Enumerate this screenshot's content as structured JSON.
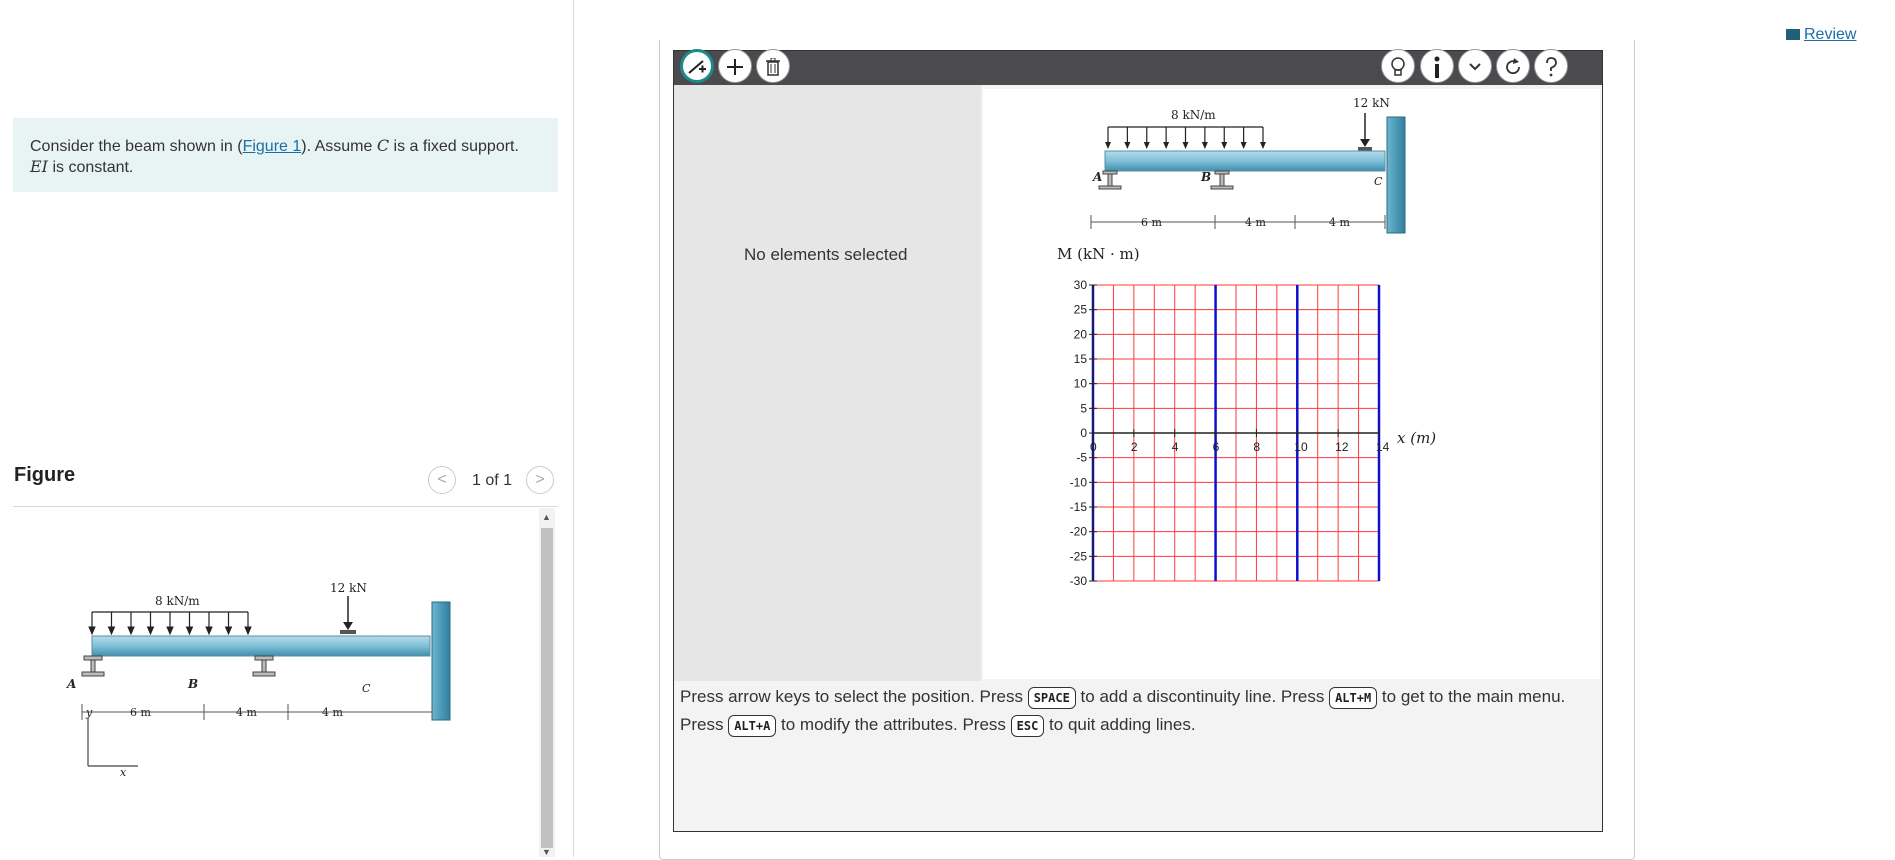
{
  "problem": {
    "text_pre": "Consider the beam shown in (",
    "figure_link": "Figure 1",
    "text_mid": "). Assume ",
    "support_symbol": "C",
    "text_post": " is a fixed support.",
    "ei_symbol": "EI",
    "ei_text": " is constant."
  },
  "figure_panel": {
    "heading": "Figure",
    "pager": "1 of 1",
    "prev_glyph": "<",
    "next_glyph": ">"
  },
  "beam_figure": {
    "distributed_load": "8 kN/m",
    "point_load": "12 kN",
    "label_a": "A",
    "label_b": "B",
    "label_c": "C",
    "dim_1": "6 m",
    "dim_2": "4 m",
    "dim_3": "4 m",
    "axis_y": "y",
    "axis_x": "x"
  },
  "toolbar": {
    "tools": [
      "add-discontinuity-line-tool",
      "plus-icon",
      "trash-icon"
    ],
    "right_tools": [
      "hint-lightbulb-icon",
      "info-icon",
      "chevron-down-icon",
      "reset-icon",
      "help-icon"
    ]
  },
  "info_pane": {
    "status": "No elements selected"
  },
  "chart_data": {
    "type": "line",
    "ylabel": "M (kN · m)",
    "xlabel": "x (m)",
    "xlim": [
      0,
      14
    ],
    "ylim": [
      -30,
      30
    ],
    "x_ticks": [
      0,
      2,
      4,
      6,
      8,
      10,
      12,
      14
    ],
    "y_ticks": [
      30,
      25,
      20,
      15,
      10,
      5,
      0,
      -5,
      -10,
      -15,
      -20,
      -25,
      -30
    ],
    "grid": true,
    "grid_minor_step_x": 1,
    "grid_minor_step_y": 5,
    "discontinuity_lines_x": [
      0,
      6,
      10,
      14
    ],
    "series": [],
    "colors": {
      "grid": "#ff3b3b",
      "discontinuity": "#1010cc",
      "axis": "#222222"
    }
  },
  "instructions": {
    "line1": [
      {
        "t": "Press arrow keys to select the position. Press "
      },
      {
        "k": "SPACE"
      },
      {
        "t": " to add a discontinuity line. Press "
      },
      {
        "k": "ALT+M"
      },
      {
        "t": " to get to the main menu."
      }
    ],
    "line2": [
      {
        "t": "Press "
      },
      {
        "k": "ALT+A"
      },
      {
        "t": " to modify the attributes. Press "
      },
      {
        "k": "ESC"
      },
      {
        "t": " to quit adding lines."
      }
    ]
  },
  "review": {
    "label": "Review"
  }
}
